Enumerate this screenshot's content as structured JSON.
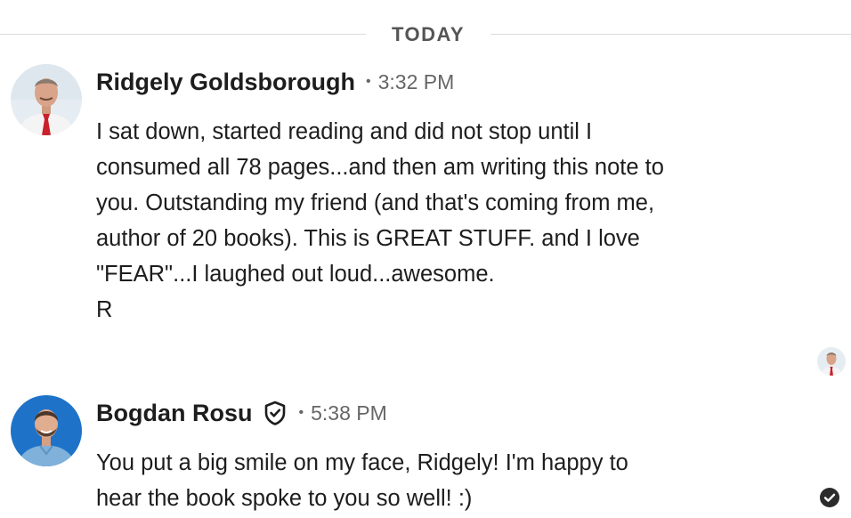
{
  "divider": {
    "label": "TODAY"
  },
  "messages": [
    {
      "sender": "Ridgely Goldsborough",
      "separator": "•",
      "time": "3:32 PM",
      "lines": [
        "I sat down, started reading and did not stop until I",
        "consumed all 78 pages...and then am writing this note to",
        "you. Outstanding my friend (and that's coming from me,",
        "author of 20 books). This is GREAT STUFF.  and I love",
        "\"FEAR\"...I laughed out loud...awesome.",
        "R"
      ]
    },
    {
      "sender": "Bogdan Rosu",
      "separator": "•",
      "time": "5:38 PM",
      "badge_icon": "shield-check-icon",
      "lines": [
        "You put a big smile on my face, Ridgely! I'm happy to",
        "hear the book spoke to you so well! :)"
      ]
    }
  ],
  "read_receipt": {
    "icon": "seen-avatar"
  },
  "status": {
    "icon": "check-circle-icon"
  }
}
